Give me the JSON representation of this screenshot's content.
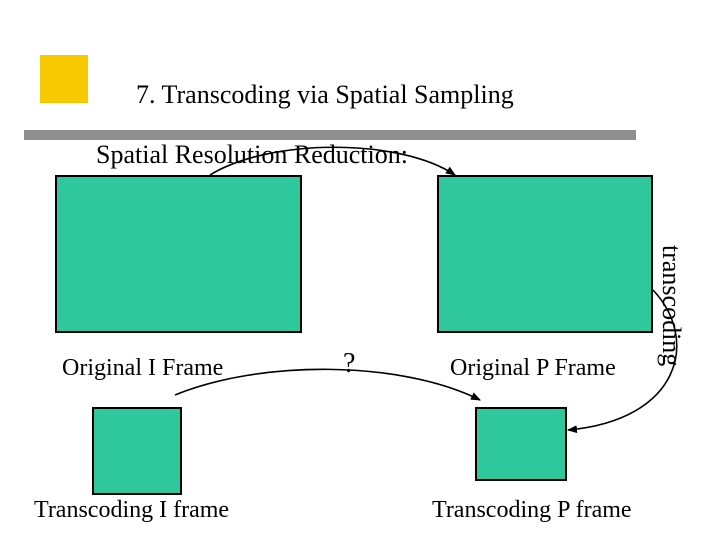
{
  "title": "7. Transcoding via Spatial Sampling",
  "subtitle": "Spatial Resolution Reduction:",
  "labels": {
    "orig_i": "Original I Frame",
    "orig_p": "Original P Frame",
    "trans_i": "Transcoding I frame",
    "trans_p": "Transcoding P frame",
    "question": "?",
    "side": "transcoding"
  },
  "colors": {
    "frame_fill": "#2fc79c",
    "accent_yellow": "#f7c900",
    "bar_grey": "#8f8f8f"
  }
}
